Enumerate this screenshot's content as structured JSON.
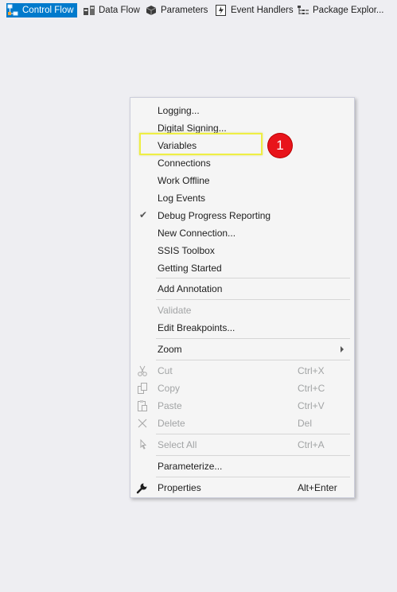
{
  "tabs": [
    {
      "label": "Control Flow",
      "icon": "control-flow-icon",
      "active": true
    },
    {
      "label": "Data Flow",
      "icon": "data-flow-icon"
    },
    {
      "label": "Parameters",
      "icon": "parameters-icon"
    },
    {
      "label": "Event Handlers",
      "icon": "event-handlers-icon"
    },
    {
      "label": "Package Explor...",
      "icon": "package-explorer-icon"
    }
  ],
  "menu": {
    "logging": {
      "label": "Logging..."
    },
    "digital_signing": {
      "label": "Digital Signing..."
    },
    "variables": {
      "label": "Variables"
    },
    "connections": {
      "label": "Connections"
    },
    "work_offline": {
      "label": "Work Offline"
    },
    "log_events": {
      "label": "Log Events"
    },
    "debug_progress": {
      "label": "Debug Progress Reporting",
      "checked": true
    },
    "new_connection": {
      "label": "New Connection..."
    },
    "ssis_toolbox": {
      "label": "SSIS Toolbox"
    },
    "getting_started": {
      "label": "Getting Started"
    },
    "add_annotation": {
      "label": "Add Annotation"
    },
    "validate": {
      "label": "Validate",
      "disabled": true
    },
    "edit_breakpoints": {
      "label": "Edit Breakpoints..."
    },
    "zoom": {
      "label": "Zoom",
      "submenu": true
    },
    "cut": {
      "label": "Cut",
      "shortcut": "Ctrl+X",
      "disabled": true,
      "icon": "scissors-icon"
    },
    "copy": {
      "label": "Copy",
      "shortcut": "Ctrl+C",
      "disabled": true,
      "icon": "copy-icon"
    },
    "paste": {
      "label": "Paste",
      "shortcut": "Ctrl+V",
      "disabled": true,
      "icon": "paste-icon"
    },
    "delete": {
      "label": "Delete",
      "shortcut": "Del",
      "disabled": true,
      "icon": "delete-icon"
    },
    "select_all": {
      "label": "Select All",
      "shortcut": "Ctrl+A",
      "disabled": true,
      "icon": "select-all-icon"
    },
    "parameterize": {
      "label": "Parameterize..."
    },
    "properties": {
      "label": "Properties",
      "shortcut": "Alt+Enter",
      "icon": "wrench-icon"
    }
  },
  "annotation": {
    "badge": "1"
  },
  "colors": {
    "accent": "#007acc",
    "highlight": "#eeee44",
    "badge": "#e8141b",
    "disabled_text": "#a2a4a5",
    "background": "#eeeef2"
  }
}
